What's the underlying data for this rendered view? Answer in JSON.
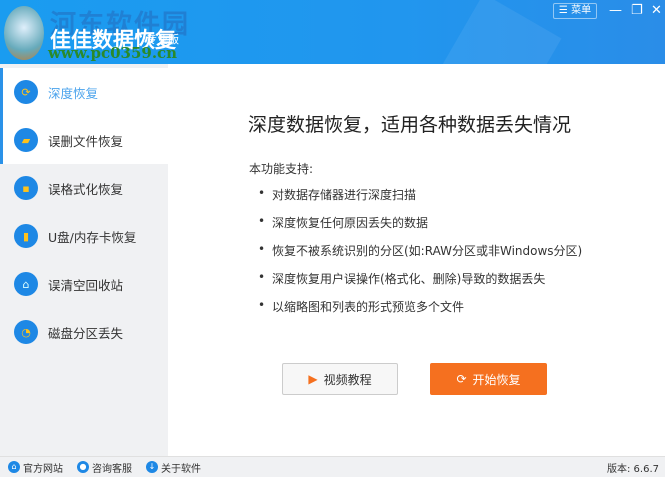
{
  "header": {
    "watermark": "河东软件园",
    "title": "佳佳数据恢复",
    "edition": "专业版",
    "site": "www.pc0359.cn",
    "menu_label": "☰ 菜单",
    "minimize": "—",
    "restore": "❐",
    "close": "✕"
  },
  "sidebar": {
    "items": [
      {
        "label": "深度恢复",
        "icon": "refresh-icon"
      },
      {
        "label": "误删文件恢复",
        "icon": "folder-icon"
      },
      {
        "label": "误格式化恢复",
        "icon": "harddisk-icon"
      },
      {
        "label": "U盘/内存卡恢复",
        "icon": "usb-icon"
      },
      {
        "label": "误清空回收站",
        "icon": "recycle-bin-icon"
      },
      {
        "label": "磁盘分区丢失",
        "icon": "pie-icon"
      }
    ]
  },
  "main": {
    "title": "深度数据恢复，适用各种数据丢失情况",
    "support_label": "本功能支持:",
    "bullets": [
      "对数据存储器进行深度扫描",
      "深度恢复任何原因丢失的数据",
      "恢复不被系统识别的分区(如:RAW分区或非Windows分区)",
      "深度恢复用户误操作(格式化、删除)导致的数据丢失",
      "以缩略图和列表的形式预览多个文件"
    ],
    "video_button": "视频教程",
    "start_button": "开始恢复"
  },
  "footer": {
    "links": [
      "官方网站",
      "咨询客服",
      "关于软件"
    ],
    "version": "版本: 6.6.7"
  },
  "colors": {
    "accent": "#1e88e5",
    "start": "#f5701f"
  }
}
